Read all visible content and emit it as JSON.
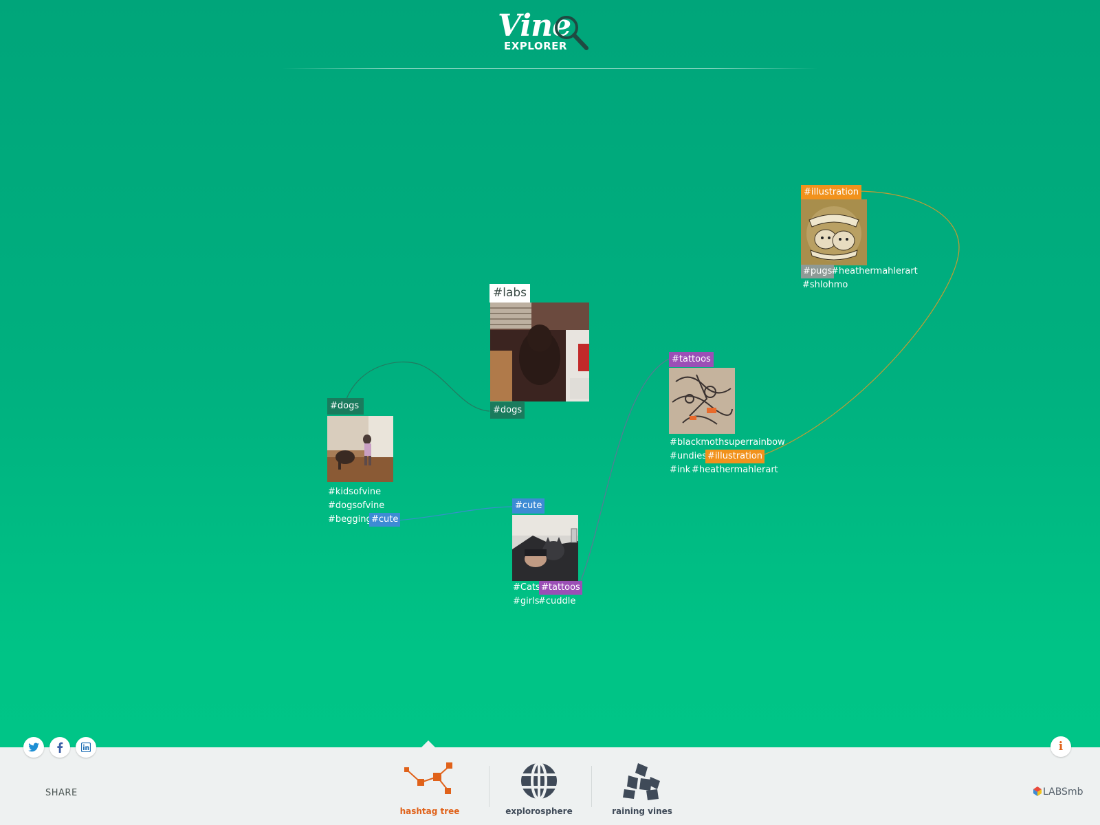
{
  "header": {
    "logo_word": "Vine",
    "logo_sub": "EXPLORER"
  },
  "nodes": {
    "labs": {
      "title": "#labs",
      "tags": [
        "#dogs"
      ]
    },
    "dogs": {
      "header": "#dogs",
      "tags": [
        "#kidsofvine",
        "#dogsofvine",
        "#begging",
        "#cute"
      ]
    },
    "cute": {
      "header": "#cute",
      "tags": [
        "#Cats",
        "#tattoos",
        "#girls",
        "#cuddle"
      ]
    },
    "tattoos": {
      "header": "#tattoos",
      "tags": [
        "#blackmothsuperrainbow",
        "#undies",
        "#illustration",
        "#ink",
        "#heathermahlerart"
      ]
    },
    "illustration": {
      "header": "#illustration",
      "tags": [
        "#pugs",
        "#heathermahlerart",
        "#shlohmo"
      ]
    }
  },
  "colors": {
    "dark": "#1a7b5d",
    "blue": "#3d8bd4",
    "purple": "#9b4fb6",
    "orange": "#f1921c",
    "gray": "#8e9a96",
    "accent": "#e0621a"
  },
  "share": {
    "label": "SHARE",
    "icons": [
      "twitter-icon",
      "facebook-icon",
      "linkedin-icon"
    ]
  },
  "nav": {
    "items": [
      {
        "label": "hashtag tree",
        "icon": "hashtag-tree-icon",
        "active": true
      },
      {
        "label": "explorosphere",
        "icon": "globe-icon",
        "active": false
      },
      {
        "label": "raining vines",
        "icon": "cubes-icon",
        "active": false
      }
    ]
  },
  "info_button": "i",
  "brand": "LABSmb"
}
